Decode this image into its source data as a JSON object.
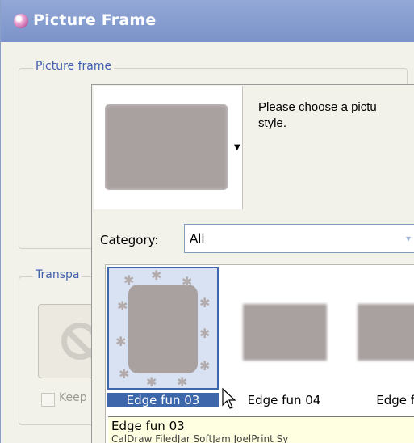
{
  "window": {
    "title": "Picture Frame",
    "accent": "#3d67aa",
    "titlebar_color": "#7b93c9"
  },
  "groups": {
    "picture_frame_label": "Picture frame",
    "transparency_label": "Transpa",
    "keep_label": "Keep"
  },
  "popup": {
    "description": "Please choose a pictu style.",
    "description_lines": [
      "Please choose a pictu",
      "style."
    ],
    "category_label": "Category:",
    "category_value": "All",
    "items": [
      {
        "label": "Edge fun 03",
        "selected": true,
        "icon": "star-border-frame-icon"
      },
      {
        "label": "Edge fun 04",
        "selected": false,
        "icon": "fuzzy-frame-icon"
      },
      {
        "label": "Edge fur",
        "selected": false,
        "icon": "fuzzy-frame-icon"
      }
    ],
    "tooltip_title": "Edge fun 03",
    "tooltip_sub": "CalDraw   FiledJar   SoftJam   JoelPrint  Sy"
  }
}
